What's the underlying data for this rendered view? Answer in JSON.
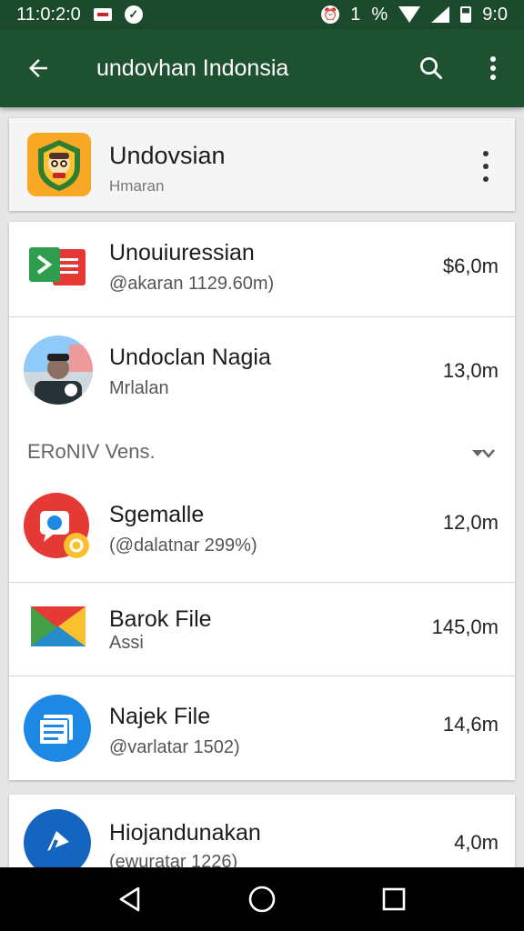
{
  "status_bar": {
    "time": "11:0:2:0",
    "battery_text": "%",
    "battery_value": "1",
    "clock_right": "9:0"
  },
  "app_bar": {
    "title": "undovhan Indonsia"
  },
  "header_item": {
    "name": "Undovsian",
    "subtitle": "Hmaran"
  },
  "list": [
    {
      "name": "Unouiuressian",
      "subtitle": "@akaran 1129.60m)",
      "size": "$6,0m",
      "icon": "green-red-app-icon"
    },
    {
      "name": "Undoclan Nagia",
      "subtitle": "Mrlalan",
      "size": "13,0m",
      "icon": "person-avatar-icon"
    }
  ],
  "section": {
    "label": "ERoNIV Vens."
  },
  "list2": [
    {
      "name": "Sgemalle",
      "subtitle": "(@dalatnar 299%)",
      "size": "12,0m",
      "icon": "red-chat-icon"
    },
    {
      "name": "Barok File",
      "subtitle": "Assi",
      "size": "145,0m",
      "icon": "envelope-icon"
    },
    {
      "name": "Najek File",
      "subtitle": "@varlatar 1502)",
      "size": "14,6m",
      "icon": "blue-doc-icon"
    }
  ],
  "bottom_item": {
    "name": "Hiojandunakan",
    "subtitle": "(ewuratar 1226)",
    "size": "4,0m",
    "icon": "blue-pin-icon"
  },
  "colors": {
    "app_bar": "#1e5130",
    "status_bar": "#1b4a2c"
  }
}
